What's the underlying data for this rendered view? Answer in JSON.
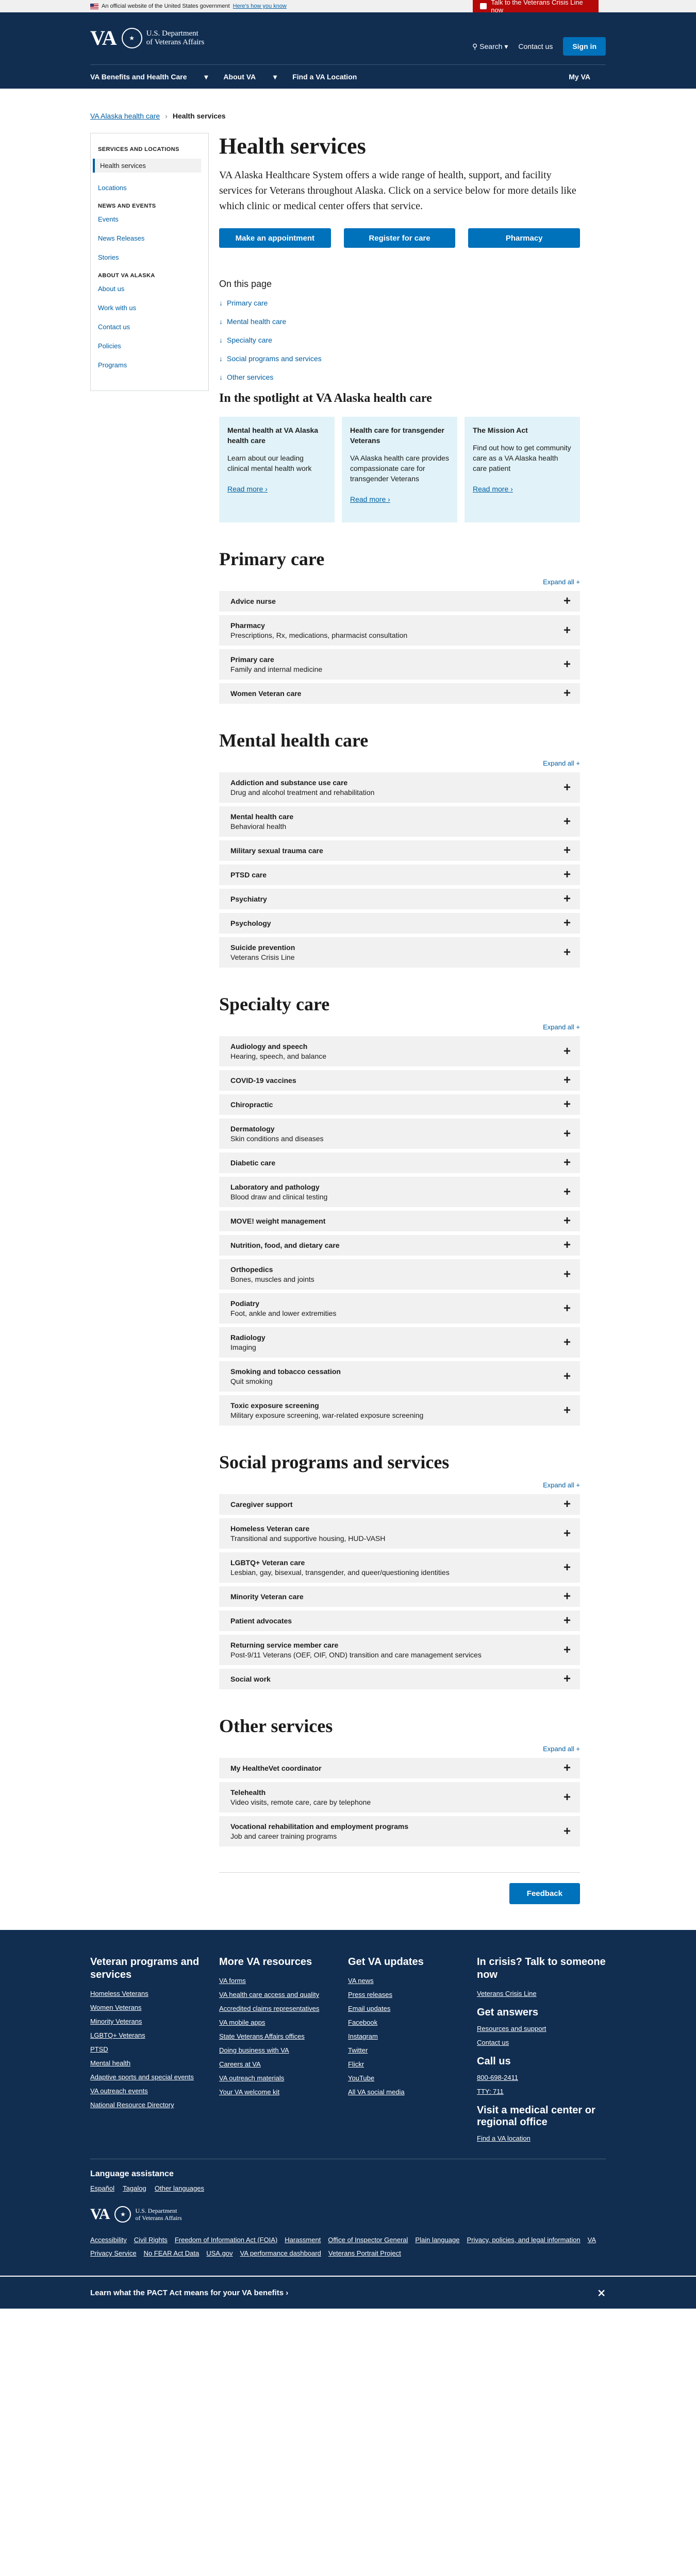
{
  "gov_banner": {
    "text": "An official website of the United States government",
    "how": "Here's how you know"
  },
  "crisis": {
    "label": "Talk to the Veterans Crisis Line now"
  },
  "header": {
    "brand": "VA",
    "dept_line1": "U.S. Department",
    "dept_line2": "of Veterans Affairs",
    "search": "Search",
    "contact": "Contact us",
    "signin": "Sign in"
  },
  "nav": {
    "items": [
      "VA Benefits and Health Care",
      "About VA",
      "Find a VA Location"
    ],
    "myva": "My VA"
  },
  "breadcrumb": [
    "VA Alaska health care",
    "Health services"
  ],
  "sidenav": {
    "section1": "SERVICES AND LOCATIONS",
    "s1items": [
      "Health services",
      "Locations"
    ],
    "section2": "NEWS AND EVENTS",
    "s2items": [
      "Events",
      "News Releases",
      "Stories"
    ],
    "section3": "ABOUT VA ALASKA",
    "s3items": [
      "About us",
      "Work with us",
      "Contact us",
      "Policies",
      "Programs"
    ]
  },
  "page": {
    "title": "Health services",
    "lede": "VA Alaska Healthcare System offers a wide range of health, support, and facility services for Veterans throughout Alaska. Click on a service below for more details like which clinic or medical center offers that service.",
    "buttons": [
      "Make an appointment",
      "Register for care",
      "Pharmacy"
    ],
    "on_this_page": "On this page",
    "otp_links": [
      "Primary care",
      "Mental health care",
      "Specialty care",
      "Social programs and services",
      "Other services"
    ],
    "spotlight_title": "In the spotlight at VA Alaska health care",
    "cards": [
      {
        "title": "Mental health at VA Alaska health care",
        "body": "Learn about our leading clinical mental health work",
        "link": "Read more ›"
      },
      {
        "title": "Health care for transgender Veterans",
        "body": "VA Alaska health care provides compassionate care for transgender Veterans",
        "link": "Read more ›"
      },
      {
        "title": "The Mission Act",
        "body": "Find out how to get community care as a VA Alaska health care patient",
        "link": "Read more ›"
      }
    ],
    "expand_all": "Expand all +",
    "feedback": "Feedback"
  },
  "sections": [
    {
      "title": "Primary care",
      "items": [
        {
          "t": "Advice nurse",
          "s": ""
        },
        {
          "t": "Pharmacy",
          "s": "Prescriptions, Rx, medications, pharmacist consultation"
        },
        {
          "t": "Primary care",
          "s": "Family and internal medicine"
        },
        {
          "t": "Women Veteran care",
          "s": ""
        }
      ]
    },
    {
      "title": "Mental health care",
      "items": [
        {
          "t": "Addiction and substance use care",
          "s": "Drug and alcohol treatment and rehabilitation"
        },
        {
          "t": "Mental health care",
          "s": "Behavioral health"
        },
        {
          "t": "Military sexual trauma care",
          "s": ""
        },
        {
          "t": "PTSD care",
          "s": ""
        },
        {
          "t": "Psychiatry",
          "s": ""
        },
        {
          "t": "Psychology",
          "s": ""
        },
        {
          "t": "Suicide prevention",
          "s": "Veterans Crisis Line"
        }
      ]
    },
    {
      "title": "Specialty care",
      "items": [
        {
          "t": "Audiology and speech",
          "s": "Hearing, speech, and balance"
        },
        {
          "t": "COVID-19 vaccines",
          "s": ""
        },
        {
          "t": "Chiropractic",
          "s": ""
        },
        {
          "t": "Dermatology",
          "s": "Skin conditions and diseases"
        },
        {
          "t": "Diabetic care",
          "s": ""
        },
        {
          "t": "Laboratory and pathology",
          "s": "Blood draw and clinical testing"
        },
        {
          "t": "MOVE! weight management",
          "s": ""
        },
        {
          "t": "Nutrition, food, and dietary care",
          "s": ""
        },
        {
          "t": "Orthopedics",
          "s": "Bones, muscles and joints"
        },
        {
          "t": "Podiatry",
          "s": "Foot, ankle and lower extremities"
        },
        {
          "t": "Radiology",
          "s": "Imaging"
        },
        {
          "t": "Smoking and tobacco cessation",
          "s": "Quit smoking"
        },
        {
          "t": "Toxic exposure screening",
          "s": "Military exposure screening, war-related exposure screening"
        }
      ]
    },
    {
      "title": "Social programs and services",
      "items": [
        {
          "t": "Caregiver support",
          "s": ""
        },
        {
          "t": "Homeless Veteran care",
          "s": "Transitional and supportive housing, HUD-VASH"
        },
        {
          "t": "LGBTQ+ Veteran care",
          "s": "Lesbian, gay, bisexual, transgender, and queer/questioning identities"
        },
        {
          "t": "Minority Veteran care",
          "s": ""
        },
        {
          "t": "Patient advocates",
          "s": ""
        },
        {
          "t": "Returning service member care",
          "s": "Post-9/11 Veterans (OEF, OIF, OND) transition and care management services"
        },
        {
          "t": "Social work",
          "s": ""
        }
      ]
    },
    {
      "title": "Other services",
      "items": [
        {
          "t": "My HealtheVet coordinator",
          "s": ""
        },
        {
          "t": "Telehealth",
          "s": "Video visits, remote care, care by telephone"
        },
        {
          "t": "Vocational rehabilitation and employment programs",
          "s": "Job and career training programs"
        }
      ]
    }
  ],
  "footer": {
    "col1": {
      "title": "Veteran programs and services",
      "links": [
        "Homeless Veterans",
        "Women Veterans",
        "Minority Veterans",
        "LGBTQ+ Veterans",
        "PTSD",
        "Mental health",
        "Adaptive sports and special events",
        "VA outreach events",
        "National Resource Directory"
      ]
    },
    "col2": {
      "title": "More VA resources",
      "links": [
        "VA forms",
        "VA health care access and quality",
        "Accredited claims representatives",
        "VA mobile apps",
        "State Veterans Affairs offices",
        "Doing business with VA",
        "Careers at VA",
        "VA outreach materials",
        "Your VA welcome kit"
      ]
    },
    "col3": {
      "title": "Get VA updates",
      "links": [
        "VA news",
        "Press releases",
        "Email updates",
        "Facebook",
        "Instagram",
        "Twitter",
        "Flickr",
        "YouTube",
        "All VA social media"
      ]
    },
    "col4": {
      "title": "In crisis? Talk to someone now",
      "crisis_link": "Veterans Crisis Line",
      "answers": "Get answers",
      "answers_links": [
        "Resources and support",
        "Contact us"
      ],
      "call": "Call us",
      "phones": [
        "800-698-2411",
        "TTY: 711"
      ],
      "visit": "Visit a medical center or regional office",
      "visit_link": "Find a VA location"
    },
    "lang_title": "Language assistance",
    "langs": [
      "Español",
      "Tagalog",
      "Other languages"
    ],
    "bottom_links": [
      "Accessibility",
      "Civil Rights",
      "Freedom of Information Act (FOIA)",
      "Harassment",
      "Office of Inspector General",
      "Plain language",
      "Privacy, policies, and legal information",
      "VA Privacy Service",
      "No FEAR Act Data",
      "USA.gov",
      "VA performance dashboard",
      "Veterans Portrait Project"
    ]
  },
  "pact": {
    "text": "Learn what the PACT Act means for your VA benefits ›"
  }
}
